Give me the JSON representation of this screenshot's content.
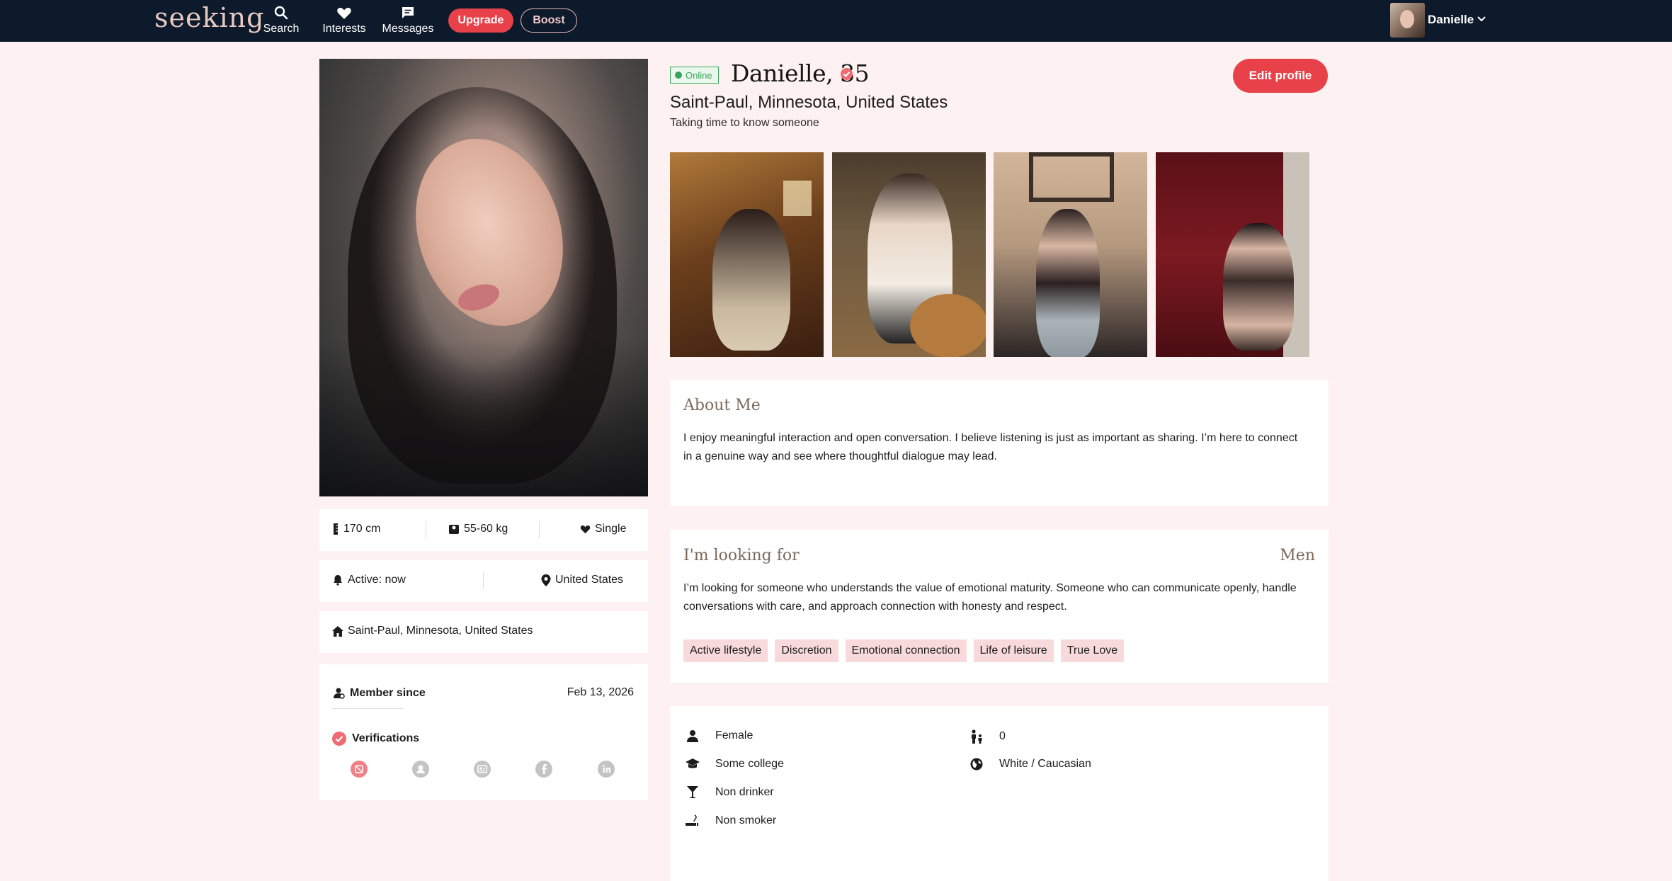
{
  "nav": {
    "logo": "seeking",
    "search_label": "Search",
    "interests_label": "Interests",
    "messages_label": "Messages",
    "upgrade_label": "Upgrade",
    "boost_label": "Boost",
    "username": "Danielle"
  },
  "profile": {
    "online_label": "Online",
    "name_age": "Danielle, 35",
    "location": "Saint-Paul, Minnesota, United States",
    "tagline": "Taking time to know someone",
    "edit_label": "Edit profile"
  },
  "stats": {
    "height": "170 cm",
    "weight": "55-60 kg",
    "relationship": "Single",
    "active": "Active: now",
    "country": "United States",
    "home": "Saint-Paul, Minnesota, United States"
  },
  "member": {
    "since_label": "Member since",
    "since_date": "Feb 13, 2026",
    "verifications_label": "Verifications",
    "verification_icons": [
      "photo-verified-icon",
      "profile-icon",
      "id-card-icon",
      "facebook-icon",
      "linkedin-icon"
    ]
  },
  "about": {
    "title": "About Me",
    "text": "I enjoy meaningful interaction and open conversation. I believe listening is just as important as sharing. I’m here to connect in a genuine way and see where thoughtful dialogue may lead."
  },
  "looking": {
    "title": "I'm looking for",
    "seeking": "Men",
    "text": "I’m looking for someone who understands the value of emotional maturity. Someone who can communicate openly, handle conversations with care, and approach connection with honesty and respect.",
    "tags": [
      "Active lifestyle",
      "Discretion",
      "Emotional connection",
      "Life of leisure",
      "True Love"
    ]
  },
  "details": {
    "gender": "Female",
    "education": "Some college",
    "drinking": "Non drinker",
    "smoking": "Non smoker",
    "children": "0",
    "ethnicity": "White / Caucasian"
  },
  "colors": {
    "accent": "#e8414a",
    "nav_bg": "#0d1a2b",
    "page_bg": "#fdf2f1",
    "online": "#3aa45a",
    "tag_bg": "#f8d9dc"
  }
}
